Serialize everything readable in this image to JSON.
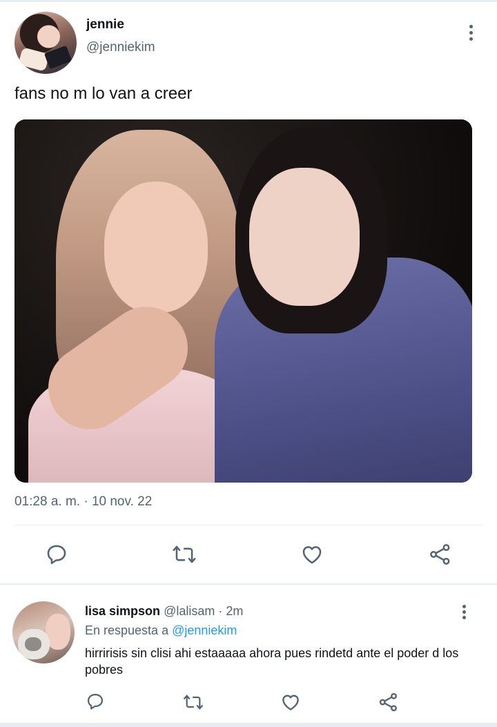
{
  "colors": {
    "text": "#0f1419",
    "secondary": "#536471",
    "link": "#1d9bf0",
    "divider": "#e6ecf0"
  },
  "tweet": {
    "name": "jennie",
    "handle": "@jenniekim",
    "text": "fans no m lo van a creer",
    "timestamp": "01:28 a. m. · 10 nov. 22",
    "actions": [
      "reply-icon",
      "retweet-icon",
      "like-icon",
      "share-icon"
    ]
  },
  "reply": {
    "name": "lisa simpson",
    "handle": "@lalisam",
    "separator": "·",
    "time": "2m",
    "replying_to_label": "En respuesta a",
    "replying_to_handle": "@jenniekim",
    "text": "hirririsis sin clisi ahi estaaaaa ahora pues rindetd ante el poder d los pobres",
    "actions": [
      "reply-icon",
      "retweet-icon",
      "like-icon",
      "share-icon"
    ]
  }
}
